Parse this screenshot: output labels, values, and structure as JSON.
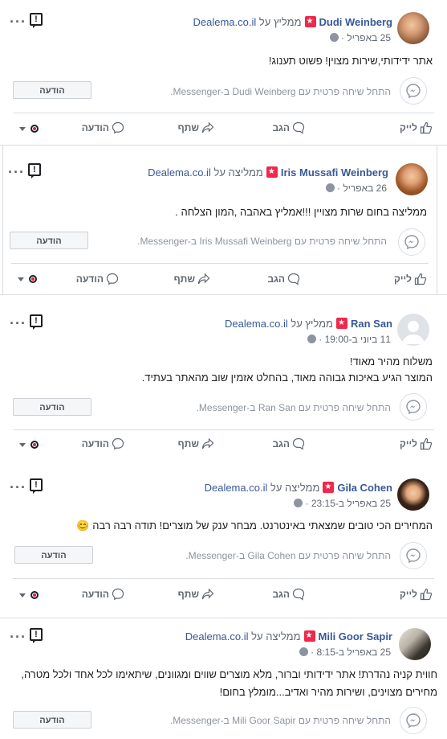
{
  "common": {
    "send_message_button": "הודעה",
    "like_label": "לייק",
    "comment_label": "הגב",
    "share_label": "שתף",
    "message_label": "הודעה",
    "page_name": "Dealema.co.il"
  },
  "reviews": [
    {
      "name": "Dudi Weinberg",
      "recommends": "ממליץ על",
      "date": "25 באפריל",
      "body": [
        "אתר ידידותי,שירות מצוין! פשוט תענוג!"
      ],
      "messenger_prompt": "התחל שיחה פרטית עם Dudi Weinberg ב-Messenger."
    },
    {
      "name": "Iris Mussafi Weinberg",
      "recommends": "ממליצה על",
      "date": "26 באפריל",
      "body": [
        "ממליצה בחום שרות מצויין !!!אמליץ באהבה ,המון הצלחה ."
      ],
      "messenger_prompt": "התחל שיחה פרטית עם Iris Mussafi Weinberg ב-Messenger."
    },
    {
      "name": "Ran San",
      "recommends": "ממליץ על",
      "date": "11 ביוני ב-19:00",
      "body": [
        "משלוח מהיר מאוד!",
        "המוצר הגיע באיכות גבוהה מאוד, בהחלט אזמין שוב מהאתר בעתיד."
      ],
      "messenger_prompt": "התחל שיחה פרטית עם Ran San ב-Messenger."
    },
    {
      "name": "Gila Cohen",
      "recommends": "ממליצה על",
      "date": "25 באפריל ב-23:15",
      "body": [
        "המחירים הכי טובים שמצאתי באינטרנט. מבחר ענק של מוצרים! תודה רבה רבה 😊"
      ],
      "messenger_prompt": "התחל שיחה פרטית עם Gila Cohen ב-Messenger."
    },
    {
      "name": "Mili Goor Sapir",
      "recommends": "ממליצה על",
      "date": "25 באפריל ב-8:15",
      "body": [
        "חווית קניה נהדרת! אתר ידידותי וברור, מלא מוצרים שווים ומגוונים, שיתאימו לכל אחד ולכל מטרה,",
        "מחירים מצוינים, ושירות מהיר ואדיב...מומלץ בחום!"
      ],
      "messenger_prompt": "התחל שיחה פרטית עם Mili Goor Sapir ב-Messenger."
    }
  ],
  "colors": {
    "name_link": "#385898",
    "recommend_badge": "#f0284a",
    "muted_text": "#606770"
  },
  "icons": [
    "more-dots-icon",
    "report-icon",
    "globe-icon",
    "messenger-icon",
    "like-icon",
    "comment-icon",
    "share-icon",
    "message-icon",
    "profile-selector-icon"
  ]
}
